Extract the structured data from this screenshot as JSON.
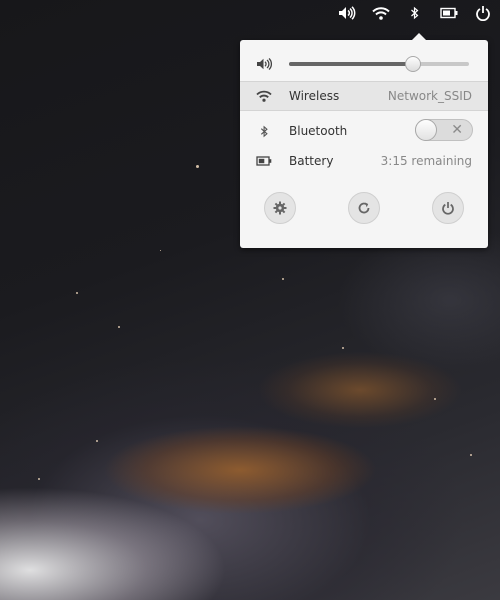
{
  "panel": {
    "indicators": [
      {
        "icon": "volume-icon"
      },
      {
        "icon": "wifi-icon"
      },
      {
        "icon": "bluetooth-icon"
      },
      {
        "icon": "battery-icon"
      },
      {
        "icon": "power-icon"
      }
    ]
  },
  "menu": {
    "volume": {
      "icon": "volume-icon",
      "level_fraction": 0.69
    },
    "wireless": {
      "icon": "wifi-icon",
      "label": "Wireless",
      "value": "Network_SSID"
    },
    "bluetooth": {
      "icon": "bluetooth-icon",
      "label": "Bluetooth",
      "enabled": false
    },
    "battery": {
      "icon": "battery-icon",
      "label": "Battery",
      "value": "3:15 remaining"
    },
    "actions": [
      {
        "icon": "gear-icon"
      },
      {
        "icon": "refresh-icon"
      },
      {
        "icon": "power-icon"
      }
    ]
  },
  "colors": {
    "popover_bg": "#f5f5f5",
    "highlight_row": "#e6e6e6"
  }
}
